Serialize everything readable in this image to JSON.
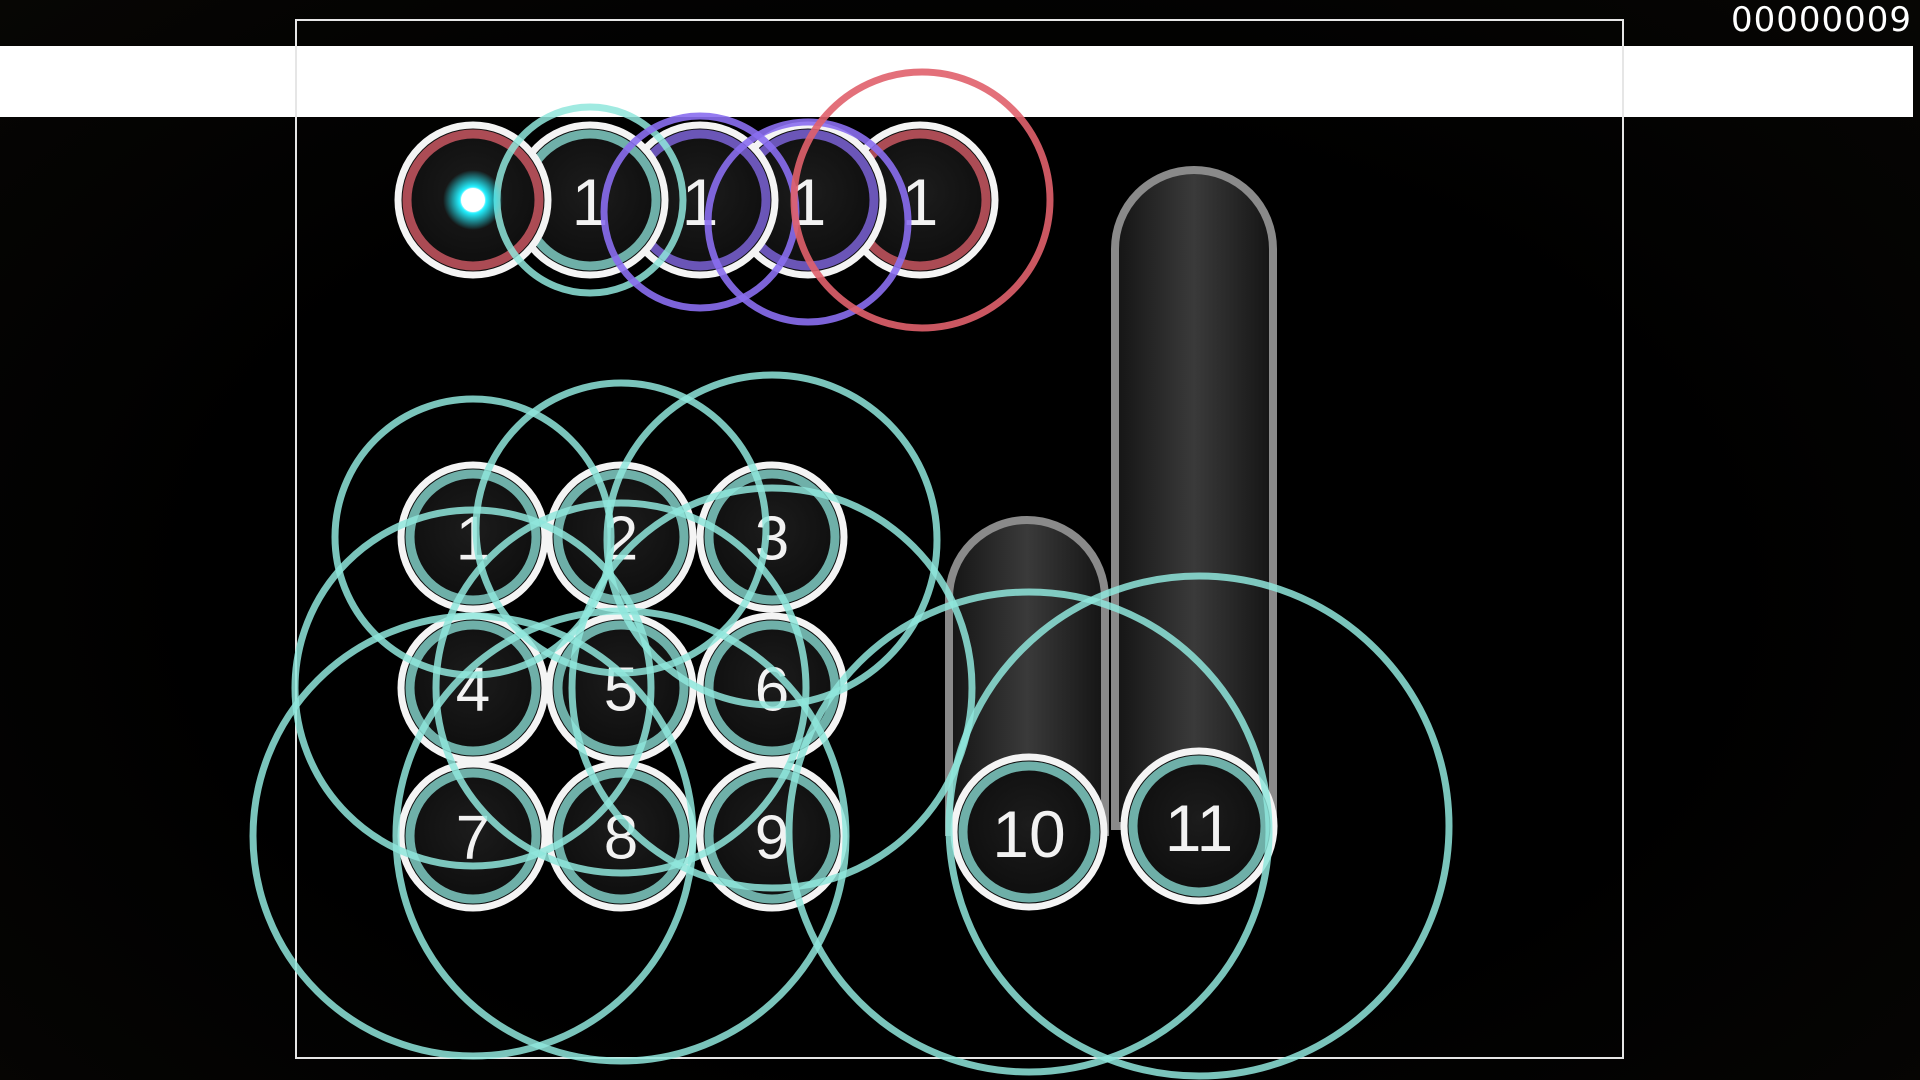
{
  "hud": {
    "score": "00000009"
  },
  "colors": {
    "background": "#000000",
    "playfield_border": "#e6e6e6",
    "banner": "#ffffff",
    "teal_combo": "#8fe6dc",
    "purple_combo": "#8a6ef0",
    "red_combo": "#e0606c",
    "cursor": "#22f0ff",
    "circle_rim": "#f4f4f4"
  },
  "top_row": {
    "circles": [
      {
        "number": "",
        "combo_color": "red",
        "has_cursor": true
      },
      {
        "number": "1",
        "combo_color": "teal"
      },
      {
        "number": "1",
        "combo_color": "purple"
      },
      {
        "number": "1",
        "combo_color": "purple"
      },
      {
        "number": "1",
        "combo_color": "red"
      }
    ]
  },
  "grid": {
    "circles": [
      {
        "number": "1"
      },
      {
        "number": "2"
      },
      {
        "number": "3"
      },
      {
        "number": "4"
      },
      {
        "number": "5"
      },
      {
        "number": "6"
      },
      {
        "number": "7"
      },
      {
        "number": "8"
      },
      {
        "number": "9"
      }
    ]
  },
  "sliders": [
    {
      "number": "10"
    },
    {
      "number": "11"
    }
  ],
  "approach_circles_count": 13
}
